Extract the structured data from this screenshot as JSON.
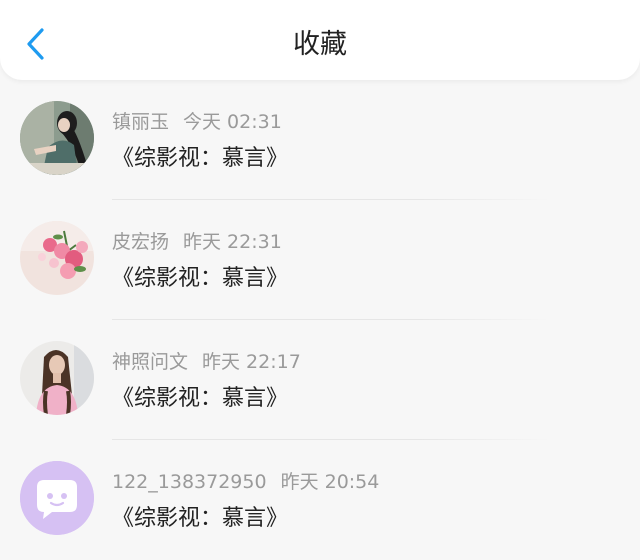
{
  "header": {
    "title": "收藏"
  },
  "items": [
    {
      "user": "镇丽玉",
      "time": "今天 02:31",
      "title": "《综影视：慕言》"
    },
    {
      "user": "皮宏扬",
      "time": "昨天 22:31",
      "title": "《综影视：慕言》"
    },
    {
      "user": "神照问文",
      "time": "昨天 22:17",
      "title": "《综影视：慕言》"
    },
    {
      "user": "122_138372950",
      "time": "昨天 20:54",
      "title": "《综影视：慕言》"
    }
  ],
  "colors": {
    "accent": "#1e9bf0",
    "default_avatar": "#d6c1f3"
  },
  "icons": {
    "back": "chevron-left-icon",
    "default_avatar": "chat-bubble-icon"
  }
}
